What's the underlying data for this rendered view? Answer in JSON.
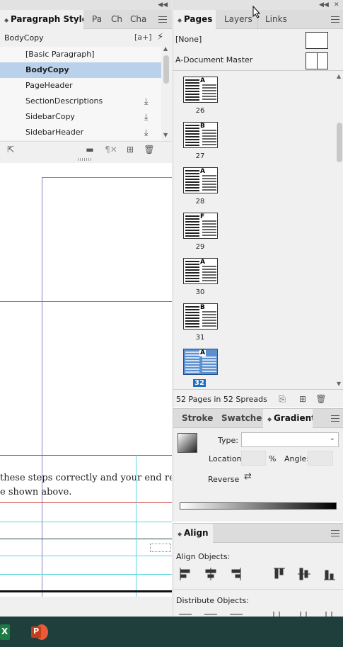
{
  "styles_panel": {
    "tabs": [
      "Paragraph Styles",
      "Pa",
      "Ch",
      "Cha"
    ],
    "current_style": "BodyCopy",
    "new_style_glyph": "[a+]",
    "items": [
      {
        "label": "[Basic Paragraph]",
        "selected": false,
        "has_import_icon": false
      },
      {
        "label": "BodyCopy",
        "selected": true,
        "has_import_icon": false
      },
      {
        "label": "PageHeader",
        "selected": false,
        "has_import_icon": false
      },
      {
        "label": "SectionDescriptions",
        "selected": false,
        "has_import_icon": true
      },
      {
        "label": "SidebarCopy",
        "selected": false,
        "has_import_icon": true
      },
      {
        "label": "SidebarHeader",
        "selected": false,
        "has_import_icon": true
      }
    ]
  },
  "document": {
    "text_line_1": "these steps correctly and your end result sl",
    "text_line_2": "e shown above."
  },
  "pages_panel": {
    "tabs": [
      "Pages",
      "Layers",
      "Links"
    ],
    "masters": [
      "[None]",
      "A-Document Master"
    ],
    "pages": [
      {
        "number": "26",
        "master": "A",
        "selected": false
      },
      {
        "number": "27",
        "master": "B",
        "selected": false
      },
      {
        "number": "28",
        "master": "A",
        "selected": false
      },
      {
        "number": "29",
        "master": "F",
        "selected": false
      },
      {
        "number": "30",
        "master": "A",
        "selected": false
      },
      {
        "number": "31",
        "master": "B",
        "selected": false
      },
      {
        "number": "32",
        "master": "A",
        "selected": true
      }
    ],
    "status": "52 Pages in 52 Spreads"
  },
  "gradient_panel": {
    "tabs": [
      "Stroke",
      "Swatches",
      "Gradient"
    ],
    "type_label": "Type:",
    "location_label": "Location:",
    "percent": "%",
    "angle_label": "Angle:",
    "reverse_label": "Reverse"
  },
  "align_panel": {
    "title": "Align",
    "align_objects_label": "Align Objects:",
    "distribute_objects_label": "Distribute Objects:"
  },
  "taskbar": {
    "apps": [
      "Excel",
      "PowerPoint"
    ],
    "excel_letter": "X",
    "ppt_letter": "P"
  },
  "colors": {
    "selection": "#b9d1ea",
    "page_selected": "#1e6fc0",
    "guide_cyan": "#5ad6e0",
    "guide_red": "#d23a3a",
    "taskbar": "#1f3f3c"
  }
}
